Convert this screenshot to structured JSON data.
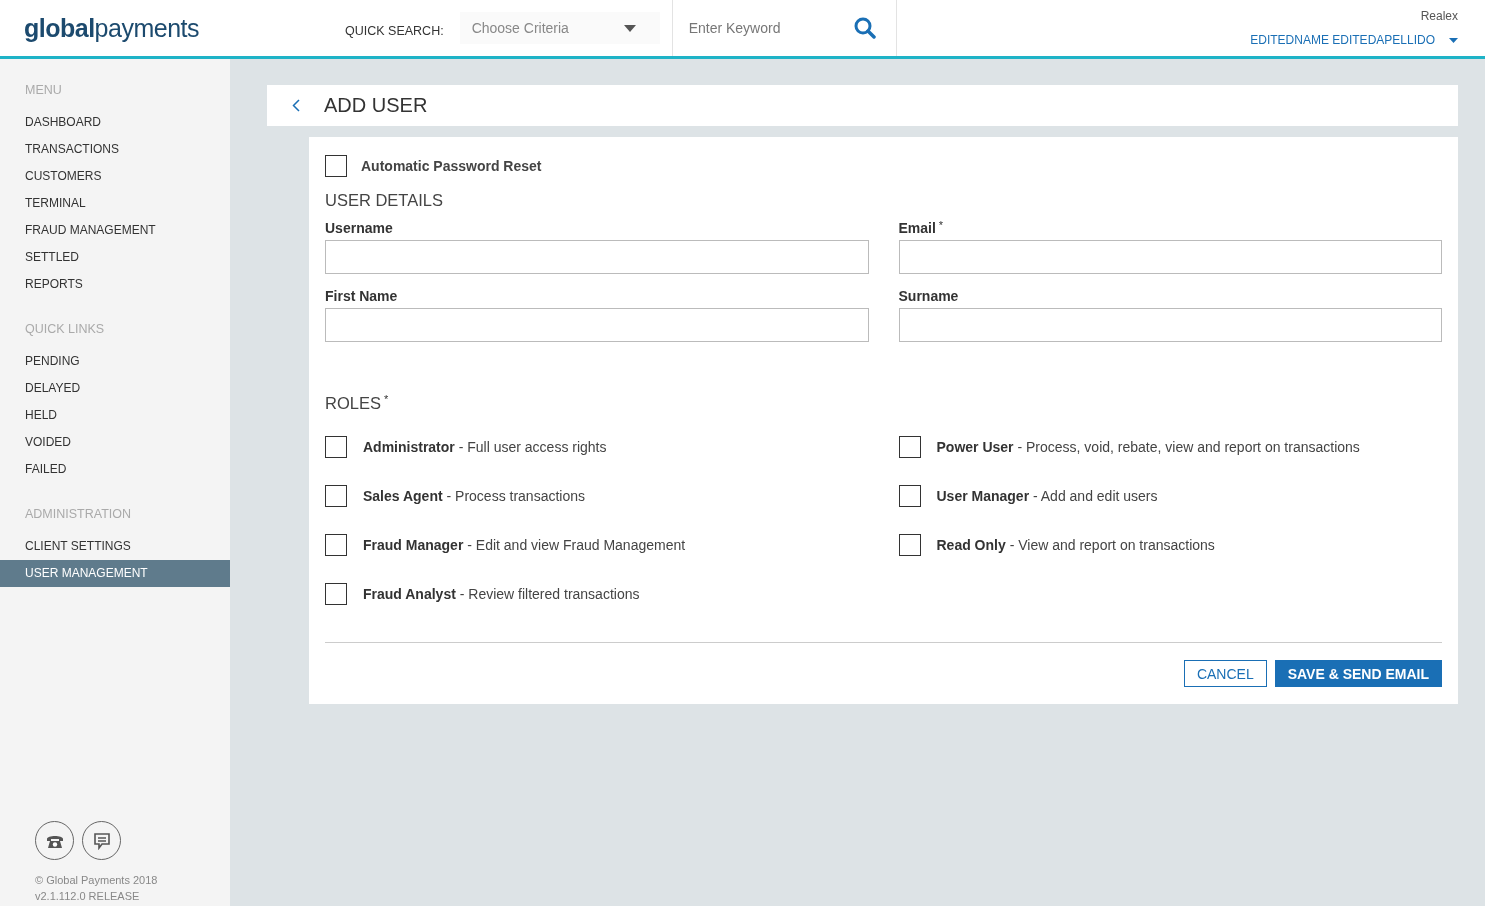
{
  "header": {
    "logo": "**global**payments",
    "quick_search_label": "QUICK SEARCH:",
    "criteria": {
      "placeholder": "Choose Criteria"
    },
    "keyword": {
      "placeholder": "Enter Keyword"
    },
    "company": "Realex",
    "user": "EDITEDNAME EDITEDAPELLIDO"
  },
  "sidebar": {
    "sections": [
      {
        "title": "MENU",
        "items": [
          {
            "label": "DASHBOARD",
            "selected": false
          },
          {
            "label": "TRANSACTIONS",
            "selected": false
          },
          {
            "label": "CUSTOMERS",
            "selected": false
          },
          {
            "label": "TERMINAL",
            "selected": false
          },
          {
            "label": "FRAUD MANAGEMENT",
            "selected": false
          },
          {
            "label": "SETTLED",
            "selected": false
          },
          {
            "label": "REPORTS",
            "selected": false
          }
        ]
      },
      {
        "title": "QUICK LINKS",
        "items": [
          {
            "label": "PENDING",
            "selected": false
          },
          {
            "label": "DELAYED",
            "selected": false
          },
          {
            "label": "HELD",
            "selected": false
          },
          {
            "label": "VOIDED",
            "selected": false
          },
          {
            "label": "FAILED",
            "selected": false
          }
        ]
      },
      {
        "title": "ADMINISTRATION",
        "items": [
          {
            "label": "CLIENT SETTINGS",
            "selected": false
          },
          {
            "label": "USER MANAGEMENT",
            "selected": true
          }
        ]
      }
    ],
    "copyright": "© Global Payments 2018",
    "version": "v2.1.112.0 RELEASE"
  },
  "page": {
    "title": "ADD USER",
    "auto_reset": {
      "label": "Automatic Password Reset",
      "checked": false
    },
    "details_title": "USER DETAILS",
    "fields": [
      {
        "label": "Username"
      },
      {
        "label": "Email",
        "required_mark": "*"
      },
      {
        "label": "First Name"
      },
      {
        "label": "Surname"
      }
    ],
    "roles_title": "ROLES",
    "roles_mark": "*",
    "roles": [
      {
        "name": "Administrator",
        "desc": " - Full user access rights",
        "checked": false
      },
      {
        "name": "Sales Agent",
        "desc": " - Process transactions",
        "checked": false
      },
      {
        "name": "Fraud Manager",
        "desc": " - Edit and view Fraud Management",
        "checked": false
      },
      {
        "name": "Fraud Analyst",
        "desc": " - Review filtered transactions",
        "checked": false
      },
      {
        "name": "Power User",
        "desc": " - Process, void, rebate, view and report on transactions",
        "checked": false
      },
      {
        "name": "User Manager",
        "desc": " - Add and edit users",
        "checked": false
      },
      {
        "name": "Read Only",
        "desc": " - View and report on transactions",
        "checked": false
      }
    ],
    "buttons": [
      {
        "label": "CANCEL",
        "kind": "secondary"
      },
      {
        "label": "SAVE & SEND EMAIL",
        "kind": "primary"
      }
    ]
  }
}
